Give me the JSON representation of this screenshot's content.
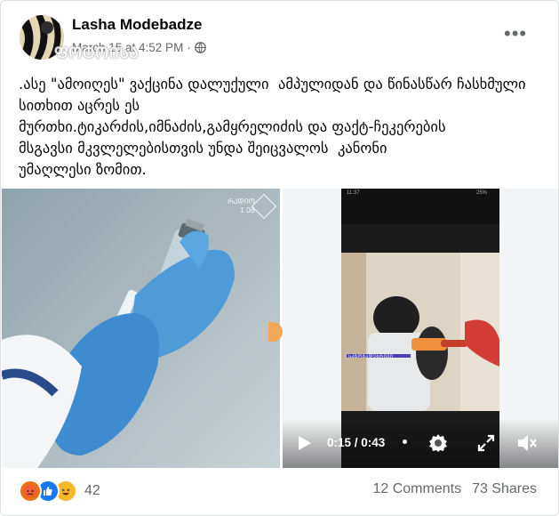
{
  "post": {
    "author": "Lasha Modebadze",
    "timestamp": "March 15 at 4:52 PM",
    "separator": "·",
    "privacy_icon": "globe-icon",
    "watermark_text": "ᲤᲝᲢᲝᲘᲡᲐ",
    "more_label": "•••",
    "text": ".ასე \"ამოიღეს\" ვაქცინა დალუქული  ამპულიდან და წინასწარ ჩასხმული სითხით აცრეს ეს\nმურთხი.ტიკარძის,იმნაძის,გამყრელიძის და ფაქტ-ჩეკერების\nმსგავსი მკვლელებისთვის უნდა შეიცვალოს  კანონი\nუმაღლესი ზომით."
  },
  "media": {
    "left_logo_line1": "ᲠᲐᲓᲘᲝ",
    "left_logo_line2": "1 ᲔᲛ",
    "video": {
      "time": "0:15 / 0:43",
      "status_time": "11:37",
      "status_right": "25%",
      "caption_strip": "ᲡᲐᲖᲝᲒᲐᲓᲔᲑᲠᲘᲕᲘ"
    }
  },
  "footer": {
    "reaction_icons": [
      "angry-react-icon",
      "like-react-icon",
      "haha-react-icon"
    ],
    "reaction_count": "42",
    "comments": "12 Comments",
    "shares": "73 Shares"
  },
  "colors": {
    "like": "#1877f2",
    "angry": "#e9710f",
    "haha": "#f7b928",
    "muted": "#65676b"
  }
}
